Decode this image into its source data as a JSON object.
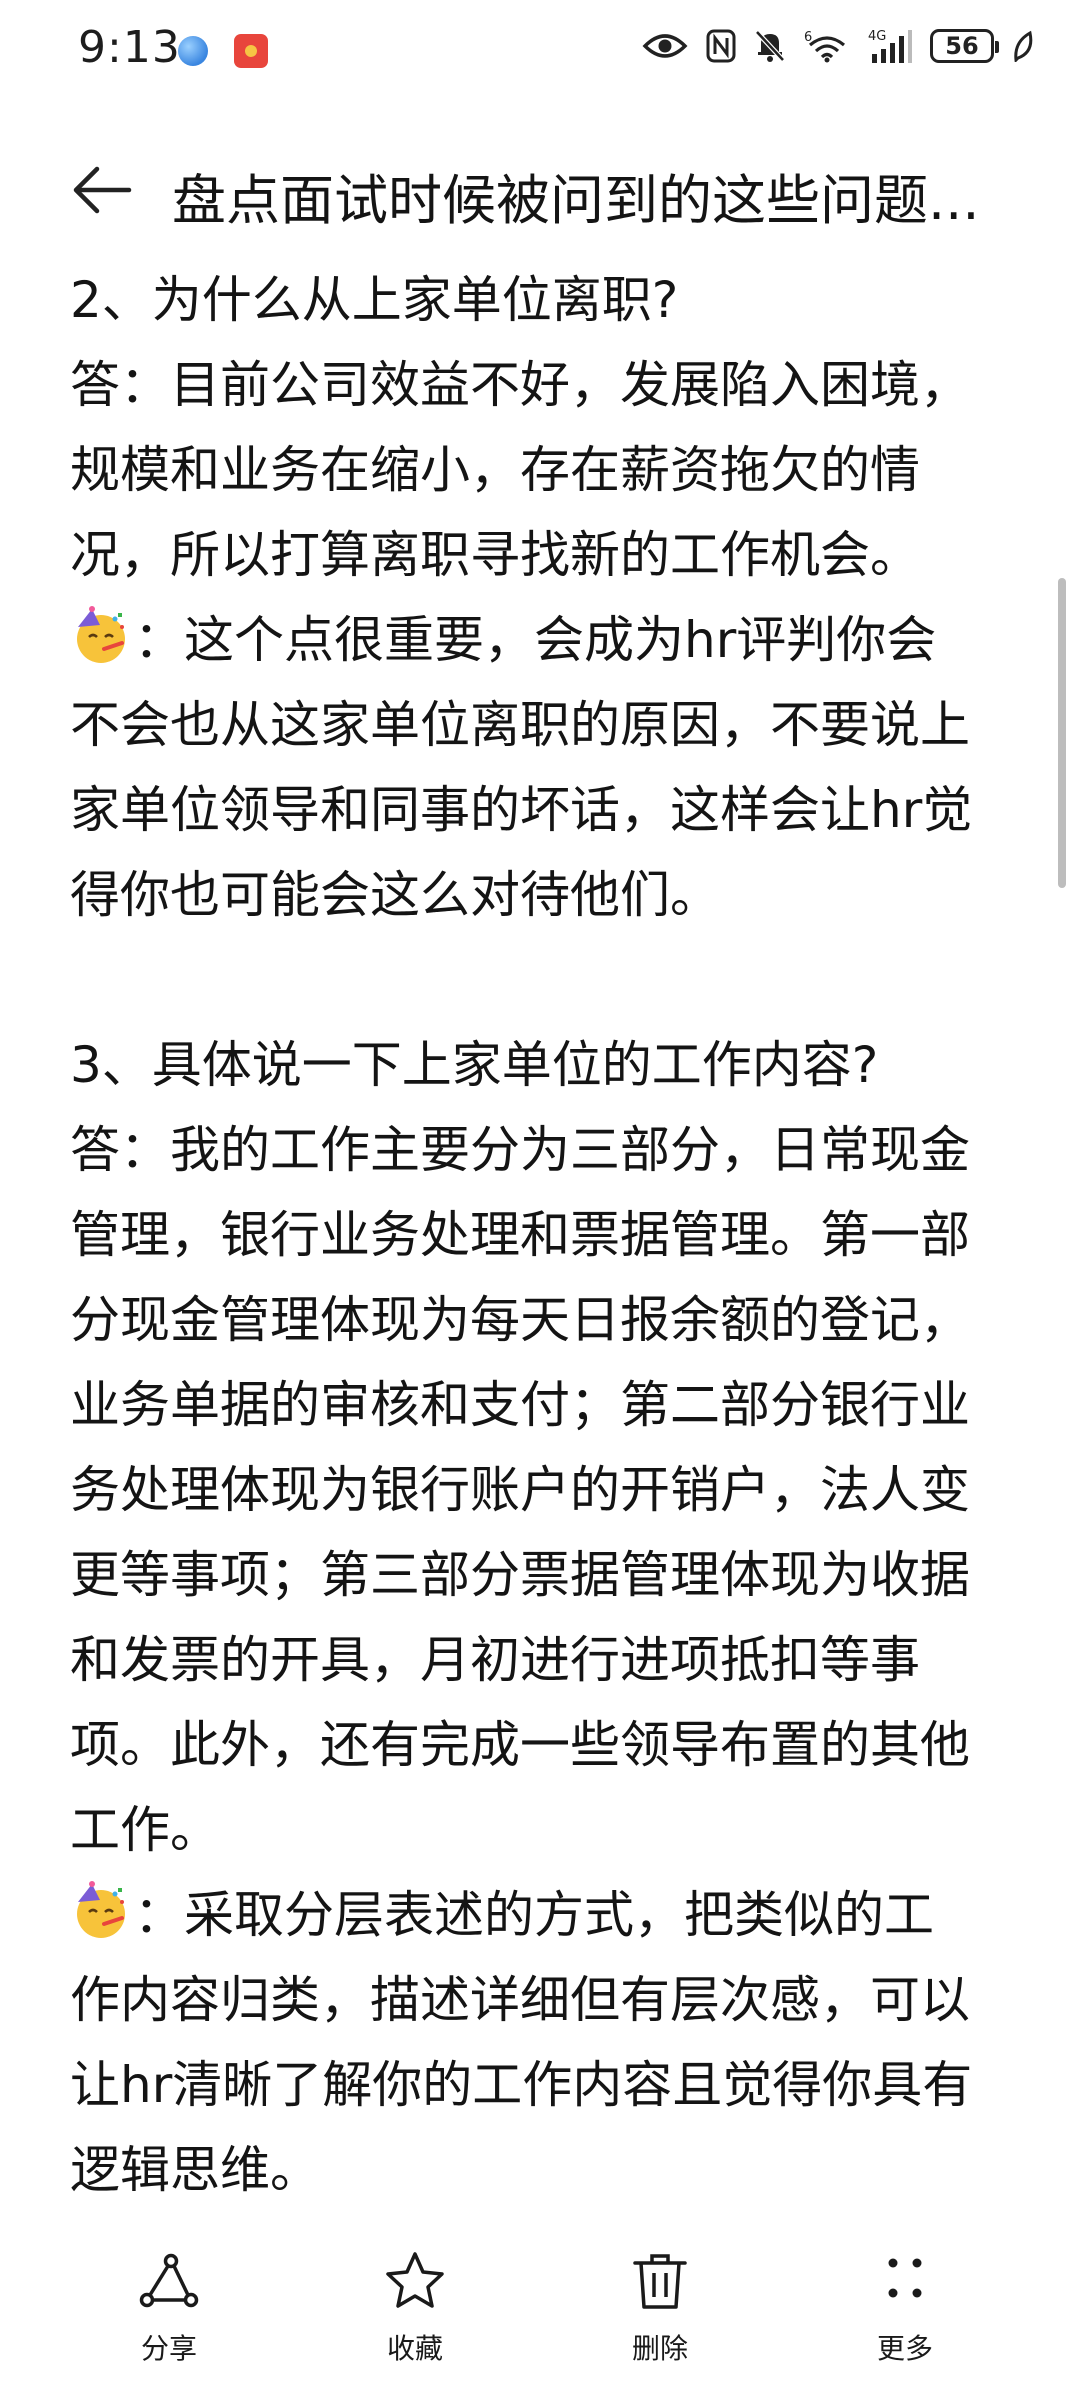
{
  "status_bar": {
    "time": "9:13",
    "battery": "56",
    "signal_label": "4G",
    "wifi_label": "6"
  },
  "header": {
    "title": "盘点面试时候被问到的这些问题..."
  },
  "content": {
    "lines": [
      {
        "text": "2、为什么从上家单位离职?"
      },
      {
        "text": "答：目前公司效益不好，发展陷入困境，"
      },
      {
        "text": "规模和业务在缩小，存在薪资拖欠的情"
      },
      {
        "text": "况，所以打算离职寻找新的工作机会。"
      },
      {
        "text": "：这个点很重要，会成为hr评判你会",
        "emoji": "party-face-emoji"
      },
      {
        "text": "不会也从这家单位离职的原因，不要说上"
      },
      {
        "text": "家单位领导和同事的坏话，这样会让hr觉"
      },
      {
        "text": "得你也可能会这么对待他们。"
      },
      {
        "text": ""
      },
      {
        "text": "3、具体说一下上家单位的工作内容?"
      },
      {
        "text": "答：我的工作主要分为三部分，日常现金"
      },
      {
        "text": "管理，银行业务处理和票据管理。第一部"
      },
      {
        "text": "分现金管理体现为每天日报余额的登记，"
      },
      {
        "text": "业务单据的审核和支付；第二部分银行业"
      },
      {
        "text": "务处理体现为银行账户的开销户，法人变"
      },
      {
        "text": "更等事项；第三部分票据管理体现为收据"
      },
      {
        "text": "和发票的开具，月初进行进项抵扣等事"
      },
      {
        "text": "项。此外，还有完成一些领导布置的其他"
      },
      {
        "text": "工作。"
      },
      {
        "text": "：采取分层表述的方式，把类似的工",
        "emoji": "party-face-emoji"
      },
      {
        "text": "作内容归类，描述详细但有层次感，可以"
      },
      {
        "text": "让hr清晰了解你的工作内容且觉得你具有"
      },
      {
        "text": "逻辑思维。"
      }
    ]
  },
  "toolbar": {
    "share_label": "分享",
    "favorite_label": "收藏",
    "delete_label": "删除",
    "more_label": "更多"
  },
  "icons": {
    "back": "arrow-left-icon",
    "share": "share-icon",
    "favorite": "star-icon",
    "delete": "trash-icon",
    "more": "more-dots-icon"
  }
}
